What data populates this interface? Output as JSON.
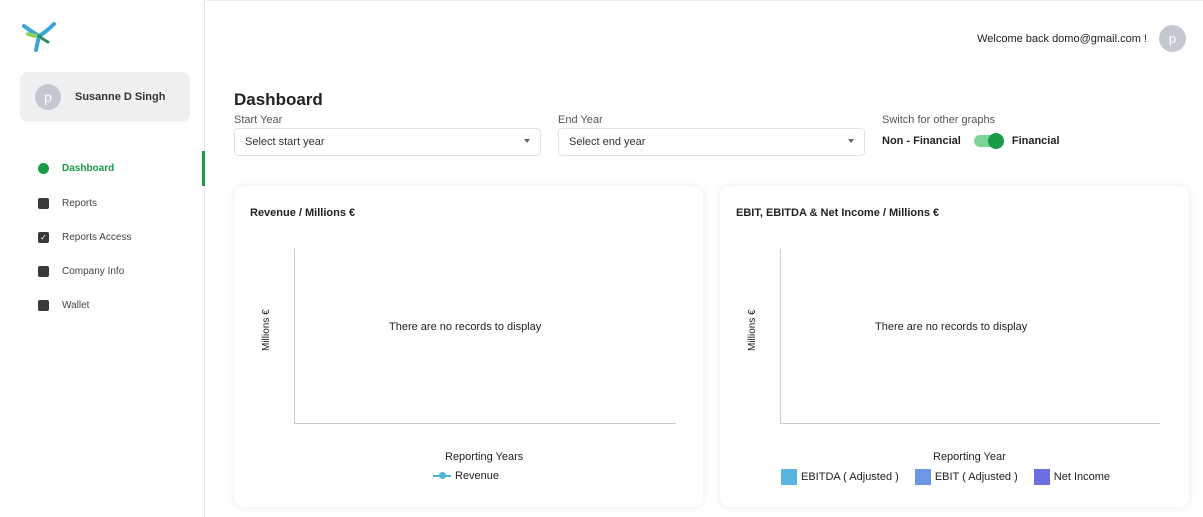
{
  "user": {
    "name": "Susanne D Singh",
    "avatar_initial": "p"
  },
  "header": {
    "welcome": "Welcome back domo@gmail.com !",
    "avatar_initial": "p"
  },
  "sidebar": {
    "items": [
      {
        "label": "Dashboard",
        "icon": "pie-chart-icon",
        "active": true
      },
      {
        "label": "Reports",
        "icon": "file-icon",
        "active": false
      },
      {
        "label": "Reports Access",
        "icon": "checkbox-icon",
        "active": false
      },
      {
        "label": "Company Info",
        "icon": "briefcase-icon",
        "active": false
      },
      {
        "label": "Wallet",
        "icon": "wallet-icon",
        "active": false
      }
    ]
  },
  "page": {
    "title": "Dashboard",
    "start_year": {
      "label": "Start Year",
      "placeholder": "Select start year"
    },
    "end_year": {
      "label": "End Year",
      "placeholder": "Select end year"
    },
    "switch": {
      "label": "Switch for other graphs",
      "left": "Non - Financial",
      "right": "Financial",
      "on": true
    }
  },
  "colors": {
    "accent": "#1a9b47",
    "ebitda": "#5ab4e0",
    "ebit": "#6b97e6",
    "net_income": "#6c6fe0",
    "revenue": "#4ab6d8"
  },
  "panels": {
    "revenue": {
      "title": "Revenue / Millions €",
      "ylabel": "Millions €",
      "xlabel": "Reporting Years",
      "empty": "There are no records to display",
      "legend": "Revenue"
    },
    "income": {
      "title": "EBIT, EBITDA & Net Income / Millions €",
      "ylabel": "Millions €",
      "xlabel": "Reporting Year",
      "empty": "There are no records to display",
      "legend": [
        "EBITDA ( Adjusted )",
        "EBIT ( Adjusted )",
        "Net Income"
      ]
    }
  },
  "chart_data": [
    {
      "type": "line",
      "title": "Revenue / Millions €",
      "xlabel": "Reporting Years",
      "ylabel": "Millions €",
      "series": [
        {
          "name": "Revenue",
          "values": []
        }
      ],
      "categories": []
    },
    {
      "type": "bar",
      "title": "EBIT, EBITDA & Net Income / Millions €",
      "xlabel": "Reporting Year",
      "ylabel": "Millions €",
      "categories": [],
      "series": [
        {
          "name": "EBITDA ( Adjusted )",
          "values": []
        },
        {
          "name": "EBIT ( Adjusted )",
          "values": []
        },
        {
          "name": "Net Income",
          "values": []
        }
      ]
    }
  ]
}
